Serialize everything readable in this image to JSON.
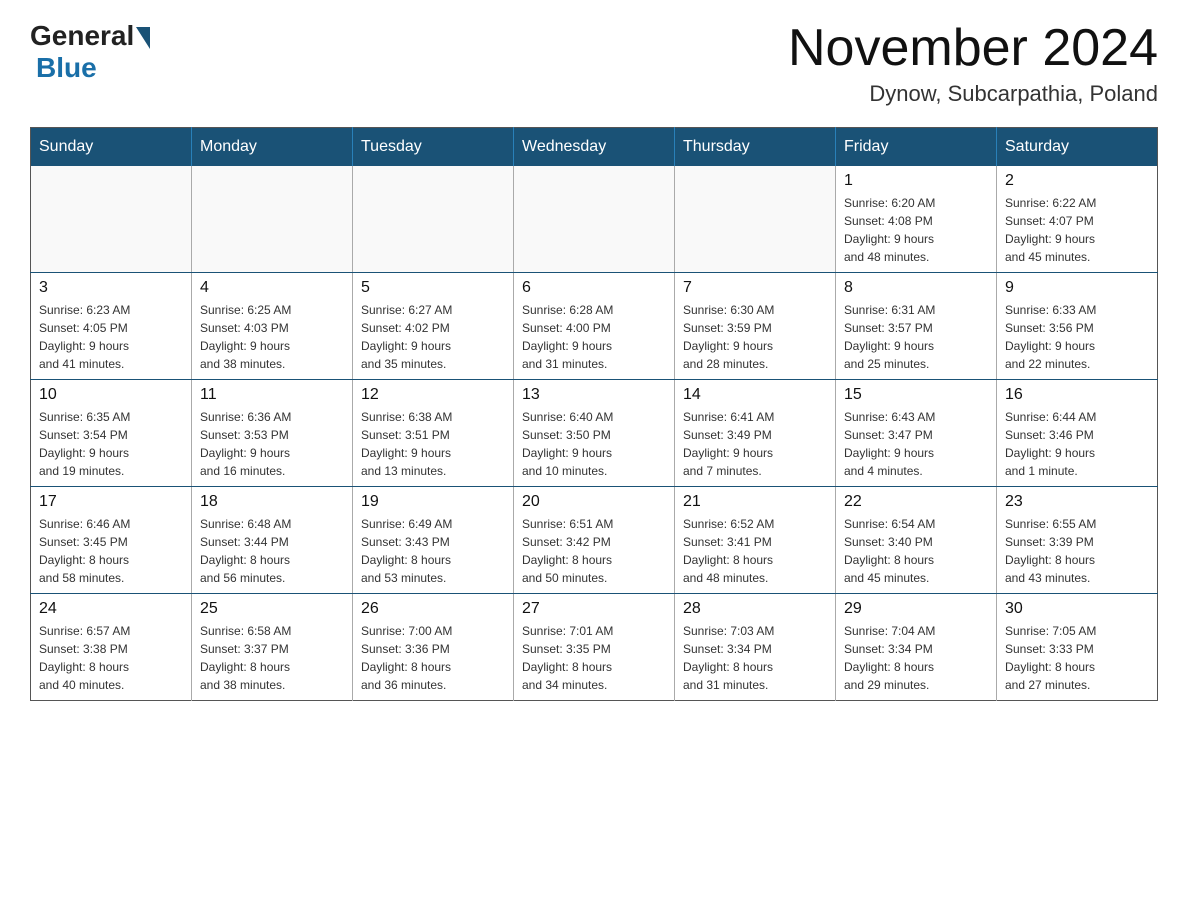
{
  "logo": {
    "general": "General",
    "blue": "Blue"
  },
  "title": "November 2024",
  "location": "Dynow, Subcarpathia, Poland",
  "days_of_week": [
    "Sunday",
    "Monday",
    "Tuesday",
    "Wednesday",
    "Thursday",
    "Friday",
    "Saturday"
  ],
  "weeks": [
    [
      {
        "day": "",
        "info": ""
      },
      {
        "day": "",
        "info": ""
      },
      {
        "day": "",
        "info": ""
      },
      {
        "day": "",
        "info": ""
      },
      {
        "day": "",
        "info": ""
      },
      {
        "day": "1",
        "info": "Sunrise: 6:20 AM\nSunset: 4:08 PM\nDaylight: 9 hours\nand 48 minutes."
      },
      {
        "day": "2",
        "info": "Sunrise: 6:22 AM\nSunset: 4:07 PM\nDaylight: 9 hours\nand 45 minutes."
      }
    ],
    [
      {
        "day": "3",
        "info": "Sunrise: 6:23 AM\nSunset: 4:05 PM\nDaylight: 9 hours\nand 41 minutes."
      },
      {
        "day": "4",
        "info": "Sunrise: 6:25 AM\nSunset: 4:03 PM\nDaylight: 9 hours\nand 38 minutes."
      },
      {
        "day": "5",
        "info": "Sunrise: 6:27 AM\nSunset: 4:02 PM\nDaylight: 9 hours\nand 35 minutes."
      },
      {
        "day": "6",
        "info": "Sunrise: 6:28 AM\nSunset: 4:00 PM\nDaylight: 9 hours\nand 31 minutes."
      },
      {
        "day": "7",
        "info": "Sunrise: 6:30 AM\nSunset: 3:59 PM\nDaylight: 9 hours\nand 28 minutes."
      },
      {
        "day": "8",
        "info": "Sunrise: 6:31 AM\nSunset: 3:57 PM\nDaylight: 9 hours\nand 25 minutes."
      },
      {
        "day": "9",
        "info": "Sunrise: 6:33 AM\nSunset: 3:56 PM\nDaylight: 9 hours\nand 22 minutes."
      }
    ],
    [
      {
        "day": "10",
        "info": "Sunrise: 6:35 AM\nSunset: 3:54 PM\nDaylight: 9 hours\nand 19 minutes."
      },
      {
        "day": "11",
        "info": "Sunrise: 6:36 AM\nSunset: 3:53 PM\nDaylight: 9 hours\nand 16 minutes."
      },
      {
        "day": "12",
        "info": "Sunrise: 6:38 AM\nSunset: 3:51 PM\nDaylight: 9 hours\nand 13 minutes."
      },
      {
        "day": "13",
        "info": "Sunrise: 6:40 AM\nSunset: 3:50 PM\nDaylight: 9 hours\nand 10 minutes."
      },
      {
        "day": "14",
        "info": "Sunrise: 6:41 AM\nSunset: 3:49 PM\nDaylight: 9 hours\nand 7 minutes."
      },
      {
        "day": "15",
        "info": "Sunrise: 6:43 AM\nSunset: 3:47 PM\nDaylight: 9 hours\nand 4 minutes."
      },
      {
        "day": "16",
        "info": "Sunrise: 6:44 AM\nSunset: 3:46 PM\nDaylight: 9 hours\nand 1 minute."
      }
    ],
    [
      {
        "day": "17",
        "info": "Sunrise: 6:46 AM\nSunset: 3:45 PM\nDaylight: 8 hours\nand 58 minutes."
      },
      {
        "day": "18",
        "info": "Sunrise: 6:48 AM\nSunset: 3:44 PM\nDaylight: 8 hours\nand 56 minutes."
      },
      {
        "day": "19",
        "info": "Sunrise: 6:49 AM\nSunset: 3:43 PM\nDaylight: 8 hours\nand 53 minutes."
      },
      {
        "day": "20",
        "info": "Sunrise: 6:51 AM\nSunset: 3:42 PM\nDaylight: 8 hours\nand 50 minutes."
      },
      {
        "day": "21",
        "info": "Sunrise: 6:52 AM\nSunset: 3:41 PM\nDaylight: 8 hours\nand 48 minutes."
      },
      {
        "day": "22",
        "info": "Sunrise: 6:54 AM\nSunset: 3:40 PM\nDaylight: 8 hours\nand 45 minutes."
      },
      {
        "day": "23",
        "info": "Sunrise: 6:55 AM\nSunset: 3:39 PM\nDaylight: 8 hours\nand 43 minutes."
      }
    ],
    [
      {
        "day": "24",
        "info": "Sunrise: 6:57 AM\nSunset: 3:38 PM\nDaylight: 8 hours\nand 40 minutes."
      },
      {
        "day": "25",
        "info": "Sunrise: 6:58 AM\nSunset: 3:37 PM\nDaylight: 8 hours\nand 38 minutes."
      },
      {
        "day": "26",
        "info": "Sunrise: 7:00 AM\nSunset: 3:36 PM\nDaylight: 8 hours\nand 36 minutes."
      },
      {
        "day": "27",
        "info": "Sunrise: 7:01 AM\nSunset: 3:35 PM\nDaylight: 8 hours\nand 34 minutes."
      },
      {
        "day": "28",
        "info": "Sunrise: 7:03 AM\nSunset: 3:34 PM\nDaylight: 8 hours\nand 31 minutes."
      },
      {
        "day": "29",
        "info": "Sunrise: 7:04 AM\nSunset: 3:34 PM\nDaylight: 8 hours\nand 29 minutes."
      },
      {
        "day": "30",
        "info": "Sunrise: 7:05 AM\nSunset: 3:33 PM\nDaylight: 8 hours\nand 27 minutes."
      }
    ]
  ]
}
